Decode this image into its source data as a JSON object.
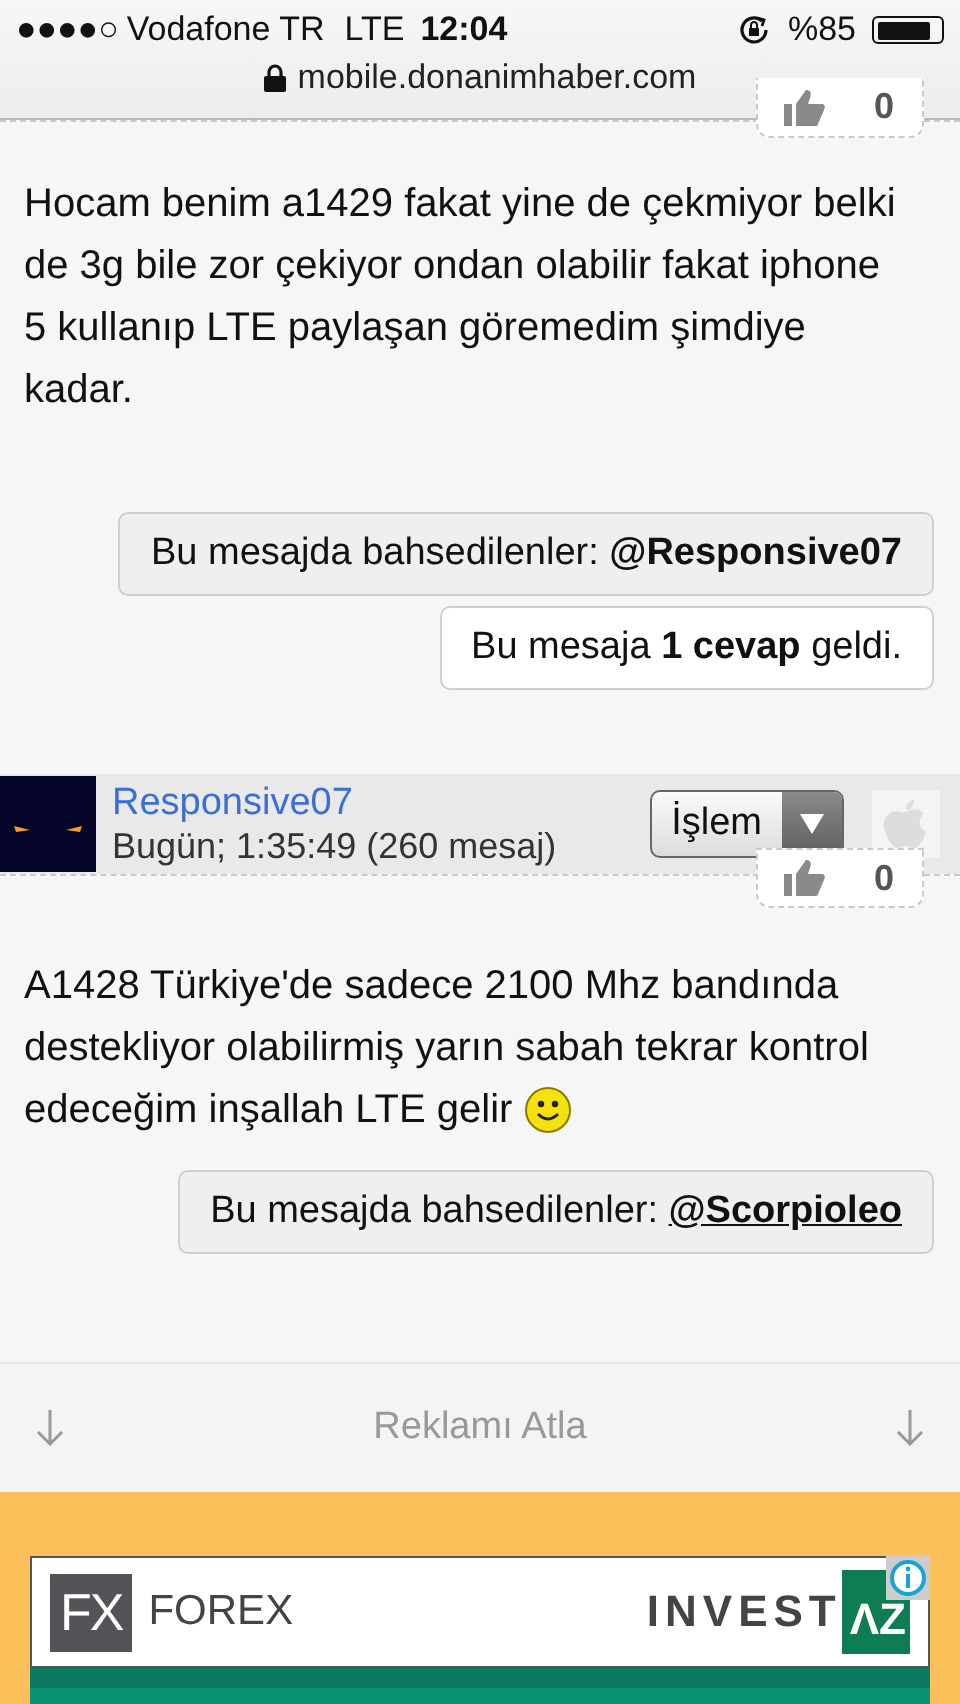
{
  "status_bar": {
    "signal_dots": "●●●●○",
    "carrier": "Vodafone TR",
    "network": "LTE",
    "time": "12:04",
    "battery": "%85"
  },
  "address_bar": {
    "url": "mobile.donanimhaber.com"
  },
  "posts": [
    {
      "like_count": "0",
      "text": "Hocam benim a1429 fakat yine de çekmiyor belki de 3g bile zor çekiyor ondan olabilir fakat iphone 5 kullanıp LTE paylaşan göremedim şimdiye kadar.",
      "smiley": false,
      "mention": {
        "label": "Bu mesajda bahsedilenler:",
        "user": "@Responsive07",
        "underlined": false
      },
      "replies": "Bu mesaja **1 cevap** geldi."
    },
    {
      "author": {
        "name": "Responsive07",
        "meta": "Bugün; 1:35:49 (260 mesaj)",
        "action": "İşlem"
      },
      "like_count": "0",
      "text": "A1428 Türkiye'de sadece 2100 Mhz bandında destekliyor olabilirmiş yarın sabah tekrar kontrol edeceğim inşallah LTE gelir",
      "smiley": true,
      "mention": {
        "label": "Bu mesajda bahsedilenler:",
        "user": "@Scorpioleo",
        "underlined": true
      }
    }
  ],
  "skip_ad": {
    "label": "Reklamı Atla"
  },
  "ad": {
    "left_mark": "FX",
    "left_name": "FOREX",
    "right_name": "INVEST",
    "right_mark": "ΛZ"
  }
}
